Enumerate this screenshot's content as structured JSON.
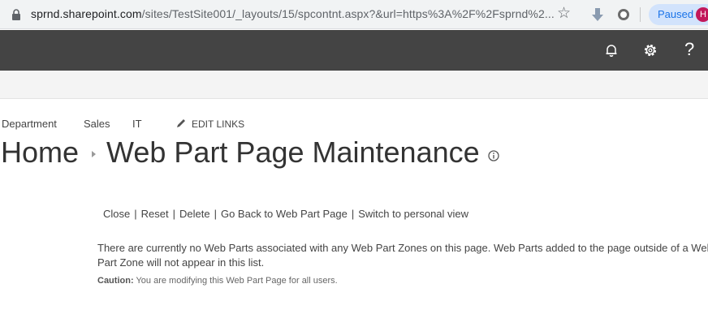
{
  "browser": {
    "url_host": "sprnd.sharepoint.com",
    "url_path": "/sites/TestSite001/_layouts/15/spcontnt.aspx?&url=https%3A%2F%2Fsprnd%2...",
    "profile_status": "Paused",
    "profile_initial": "H",
    "icons": [
      "lock-icon",
      "star-icon",
      "download-extension-icon",
      "circle-extension-icon"
    ]
  },
  "suite_bar": {
    "help_glyph": "?",
    "icons": [
      "bell-icon",
      "gear-icon",
      "help-icon"
    ]
  },
  "top_nav": {
    "items": [
      "Department",
      "Sales",
      "IT"
    ],
    "edit_links": "EDIT LINKS"
  },
  "page": {
    "breadcrumb_home": "Home",
    "title": "Web Part Page Maintenance"
  },
  "actions": {
    "items": [
      "Close",
      "Reset",
      "Delete",
      "Go Back to Web Part Page",
      "Switch to personal view"
    ],
    "separator": "|"
  },
  "message": {
    "text": "There are currently no Web Parts associated with any Web Part Zones on this page. Web Parts added to the page outside of a Web Part Zone will not appear in this list.",
    "caution_label": "Caution:",
    "caution_text": " You are modifying this Web Part Page for all users."
  },
  "colors": {
    "suite_bar": "#444444",
    "ribbon": "#f4f4f4",
    "paused_bg": "#d2e3fc",
    "paused_text": "#1a73e8",
    "avatar": "#c2185b"
  }
}
